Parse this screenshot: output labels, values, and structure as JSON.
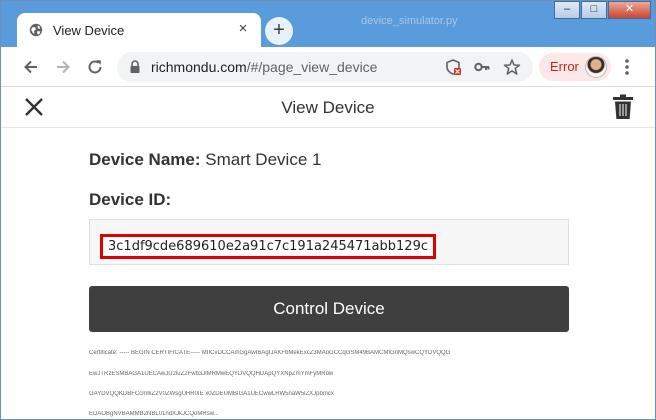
{
  "browser": {
    "tab_title": "View Device",
    "tab_close": "×",
    "new_tab": "+",
    "background_window_title": "device_simulator.py",
    "window_controls": [
      "–",
      "□",
      "✕"
    ],
    "url_host": "richmondu.com",
    "url_path": "/#/page_view_device",
    "error_chip": "Error",
    "icons": [
      "back-icon",
      "forward-icon",
      "reload-icon",
      "lock-icon",
      "blocked-icon",
      "key-icon",
      "star-icon",
      "menu-icon"
    ]
  },
  "page": {
    "title": "View Device",
    "device_name_label": "Device Name:",
    "device_name_value": "Smart Device 1",
    "device_id_label": "Device ID:",
    "device_id_value": "3c1df9cde689610e2a91c7c191a245471abb129c",
    "control_button": "Control Device",
    "certificate_lines": [
      "Certificate: ----- BEGIN CERTIFICATE----- MIICvDCCAmGgAwIBAgIJAKFbMekExcZ3MAoGCCqGSM49BAMCMIGnMQswCQYDVQQG",
      "EwJTRzESMBAGA1UECAwJU2luZ2Fwb3JlMRMwEQYDVQQHDApQYXNpZmYmFyMRow",
      "GAYDVQQKDBFCcmlkZ2V0ZWsgUHR0IE x0ZDEUMBIGA1UECwwLRW5naW5lZXJpbmcx",
      "EDAOBgNVBAMMB2NBL01ndXJkJCQoMRsw..."
    ]
  },
  "colors": {
    "titlebar": "#5a9bdb",
    "control_button": "#3f3f3f",
    "highlight_border": "#e00000",
    "error_chip_bg": "#fce8e6",
    "error_chip_text": "#c5221f"
  }
}
